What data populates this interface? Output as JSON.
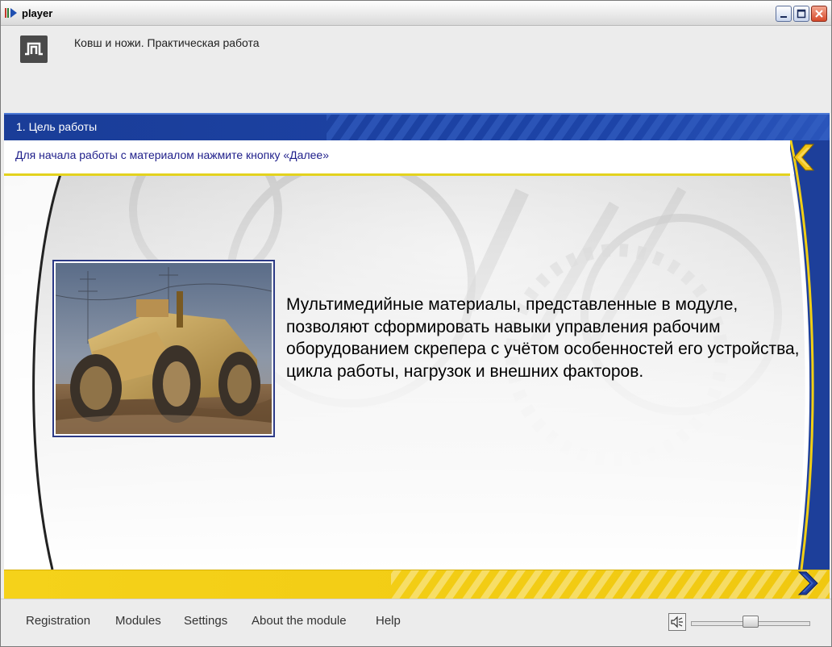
{
  "window": {
    "title": "player"
  },
  "header": {
    "course_title": "Ковш и ножи. Практическая работа"
  },
  "section": {
    "title": "1. Цель работы",
    "instruction": "Для начала работы с материалом нажмите кнопку «Далее»"
  },
  "content": {
    "text": "Мультимедийные материалы, представленные в модуле, позволяют сформировать навыки управления рабочим оборудованием скрепера с учётом особенностей его устройства, цикла работы, нагрузок и внешних факторов."
  },
  "menu": [
    {
      "label": "Registration"
    },
    {
      "label": "Modules"
    },
    {
      "label": "Settings"
    },
    {
      "label": "About the module"
    },
    {
      "label": "Help"
    }
  ],
  "volume": {
    "level": 0.5
  },
  "colors": {
    "band_blue": "#1d3f9a",
    "band_yellow": "#f2cf14",
    "arrow_yellow": "#f3c414",
    "arrow_blue": "#1c3c9c"
  },
  "icons": {
    "back": "chevron-left-icon",
    "next": "chevron-right-icon",
    "speaker": "speaker-icon"
  }
}
